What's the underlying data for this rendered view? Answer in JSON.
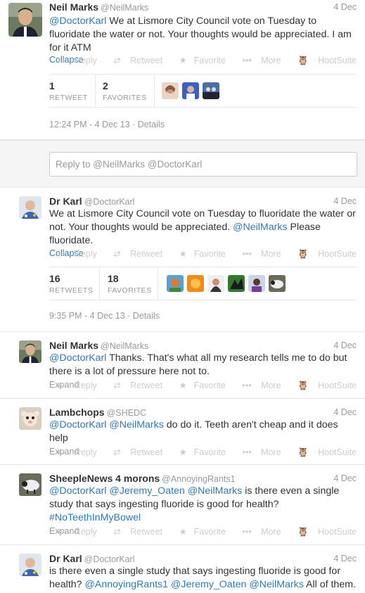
{
  "tweets": [
    {
      "name": "Neil Marks",
      "handle": "@NeilMarks",
      "date": "4 Dec",
      "text_parts": [
        {
          "m": "@DoctorKarl"
        },
        {
          "t": " We at Lismore City Council vote on Tuesday to fluoridate the water or not. Your thoughts would be appreciated. I am for it ATM"
        }
      ],
      "toggle": "Collapse",
      "stats": {
        "retweets_num": "1",
        "retweets_label": "RETWEET",
        "favorites_num": "2",
        "favorites_label": "FAVORITES"
      },
      "time": "12:24 PM - 4 Dec 13 · Details"
    },
    {
      "name": "Dr Karl",
      "handle": "@DoctorKarl",
      "date": "4 Dec",
      "text_parts": [
        {
          "t": "We at Lismore City Council vote on Tuesday to fluoridate the water or not. Your thoughts would be appreciated. "
        },
        {
          "m": "@NeilMarks"
        },
        {
          "t": " Please fluoridate."
        }
      ],
      "toggle": "Collapse",
      "stats": {
        "retweets_num": "16",
        "retweets_label": "RETWEETS",
        "favorites_num": "18",
        "favorites_label": "FAVORITES"
      },
      "time": "9:35 PM - 4 Dec 13 · Details"
    },
    {
      "name": "Neil Marks",
      "handle": "@NeilMarks",
      "date": "4 Dec",
      "text_parts": [
        {
          "m": "@DoctorKarl"
        },
        {
          "t": " Thanks. That's what all my research tells me to do but there is a lot of pressure here not to."
        }
      ],
      "toggle": "Expand"
    },
    {
      "name": "Lambchops",
      "handle": "@SHEDC",
      "date": "4 Dec",
      "text_parts": [
        {
          "m": "@DoctorKarl"
        },
        {
          "t": " "
        },
        {
          "m": "@NeilMarks"
        },
        {
          "t": "  do do it. Teeth aren't cheap and it does help"
        }
      ],
      "toggle": "Expand"
    },
    {
      "name": "SheepleNews 4 morons",
      "handle": "@AnnoyingRants1",
      "date": "4 Dec",
      "text_parts": [
        {
          "m": "@DoctorKarl"
        },
        {
          "t": " "
        },
        {
          "m": "@Jeremy_Oaten"
        },
        {
          "t": " "
        },
        {
          "m": "@NeilMarks"
        },
        {
          "t": " is there even a single study that says ingesting fluoride is good for health? "
        },
        {
          "m": "#NoTeethInMyBowel"
        }
      ],
      "toggle": "Expand"
    },
    {
      "name": "Dr Karl",
      "handle": "@DoctorKarl",
      "date": "4 Dec",
      "text_parts": [
        {
          "t": "is there even a single study that says ingesting fluoride is good for health?  "
        },
        {
          "m": "@AnnoyingRants1"
        },
        {
          "t": " "
        },
        {
          "m": "@Jeremy_Oaten"
        },
        {
          "t": " "
        },
        {
          "m": "@NeilMarks"
        },
        {
          "t": " All of them."
        }
      ]
    }
  ],
  "actions": {
    "reply": "Reply",
    "retweet": "Retweet",
    "favorite": "Favorite",
    "more": "More",
    "hootsuite": "HootSuite"
  },
  "reply_box": {
    "placeholder": "Reply to @NeilMarks @DoctorKarl"
  },
  "colors": {
    "link": "#2b7bb9",
    "muted": "#999999",
    "border": "#e8e8e8",
    "reply_bg": "#f5f5f5"
  }
}
